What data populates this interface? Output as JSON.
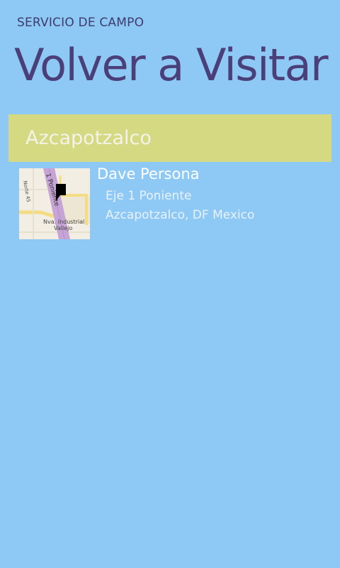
{
  "app": {
    "title": "SERVICIO DE CAMPO",
    "page_title": "Volver a Visitar"
  },
  "groups": [
    {
      "header": "Azcapotzalco",
      "items": [
        {
          "name": "Dave Persona",
          "address_line1": "Eje 1 Poniente",
          "address_line2": "Azcapotzalco, DF Mexico",
          "map": {
            "street_main": "1 Poniente",
            "street_side": "Norte 45",
            "area_line1": "Nva. Industrial",
            "area_line2": "Vallejo"
          }
        }
      ]
    }
  ],
  "colors": {
    "background": "#8ec9f5",
    "group_header": "#d4d982",
    "title_text": "#4a3f78"
  }
}
